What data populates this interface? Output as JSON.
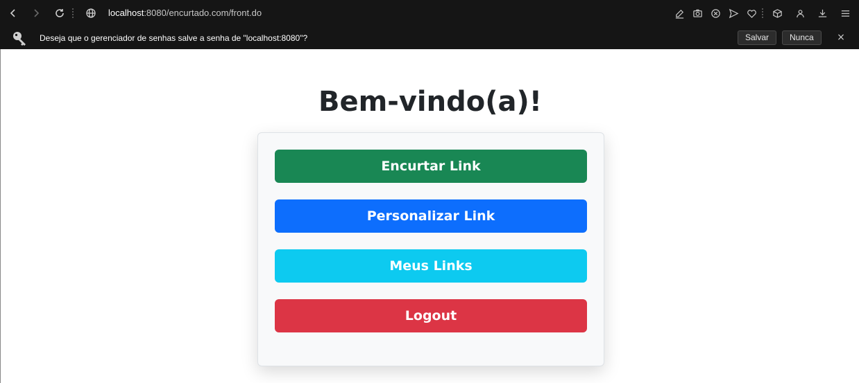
{
  "browser": {
    "url_host": "localhost",
    "url_rest": ":8080/encurtado.com/front.do"
  },
  "password_prompt": {
    "message": "Deseja que o gerenciador de senhas salve a senha de \"localhost:8080\"?",
    "save_label": "Salvar",
    "never_label": "Nunca",
    "close_label": "×"
  },
  "page": {
    "title": "Bem-vindo(a)!",
    "buttons": [
      {
        "label": "Encurtar Link",
        "color": "#198754"
      },
      {
        "label": "Personalizar Link",
        "color": "#0d6efd"
      },
      {
        "label": "Meus Links",
        "color": "#0dcaf0"
      },
      {
        "label": "Logout",
        "color": "#dc3545"
      }
    ]
  }
}
